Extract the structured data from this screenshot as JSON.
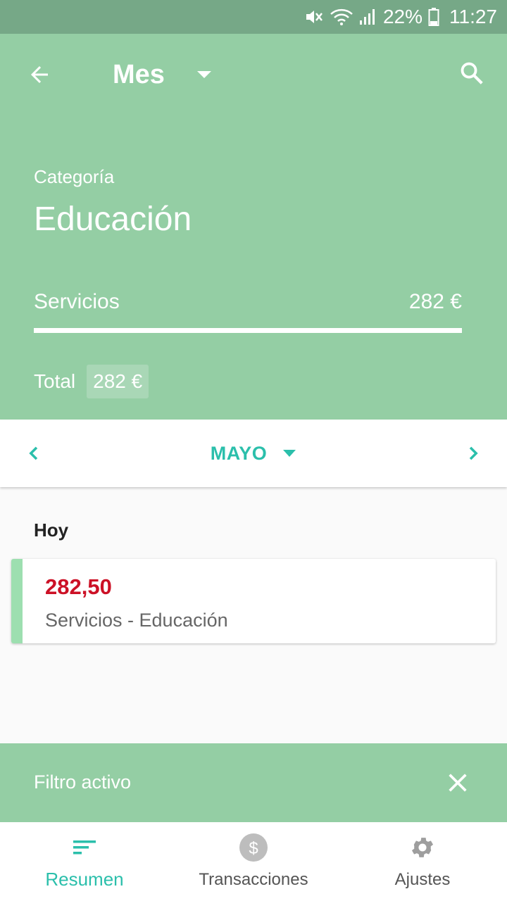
{
  "status_bar": {
    "battery_pct": "22%",
    "time": "11:27"
  },
  "header": {
    "period_label": "Mes",
    "category_caption": "Categoría",
    "category_name": "Educación",
    "subcategory": {
      "name": "Servicios",
      "amount": "282 €",
      "progress": 1.0
    },
    "total_label": "Total",
    "total_value": "282 €"
  },
  "month_nav": {
    "month_label": "MAYO"
  },
  "transactions": {
    "section_label": "Hoy",
    "items": [
      {
        "amount": "282,50",
        "description": "Servicios - Educación"
      }
    ]
  },
  "filter_bar": {
    "label": "Filtro activo"
  },
  "bottom_nav": {
    "tabs": [
      {
        "label": "Resumen",
        "icon": "sort-icon",
        "active": true
      },
      {
        "label": "Transacciones",
        "icon": "dollar-coin-icon",
        "active": false
      },
      {
        "label": "Ajustes",
        "icon": "gear-icon",
        "active": false
      }
    ]
  },
  "colors": {
    "accent": "#2bbfab",
    "header_bg": "#94cea4",
    "status_bg": "#76a887",
    "expense": "#cc1126",
    "card_stripe": "#9ddfb0"
  }
}
